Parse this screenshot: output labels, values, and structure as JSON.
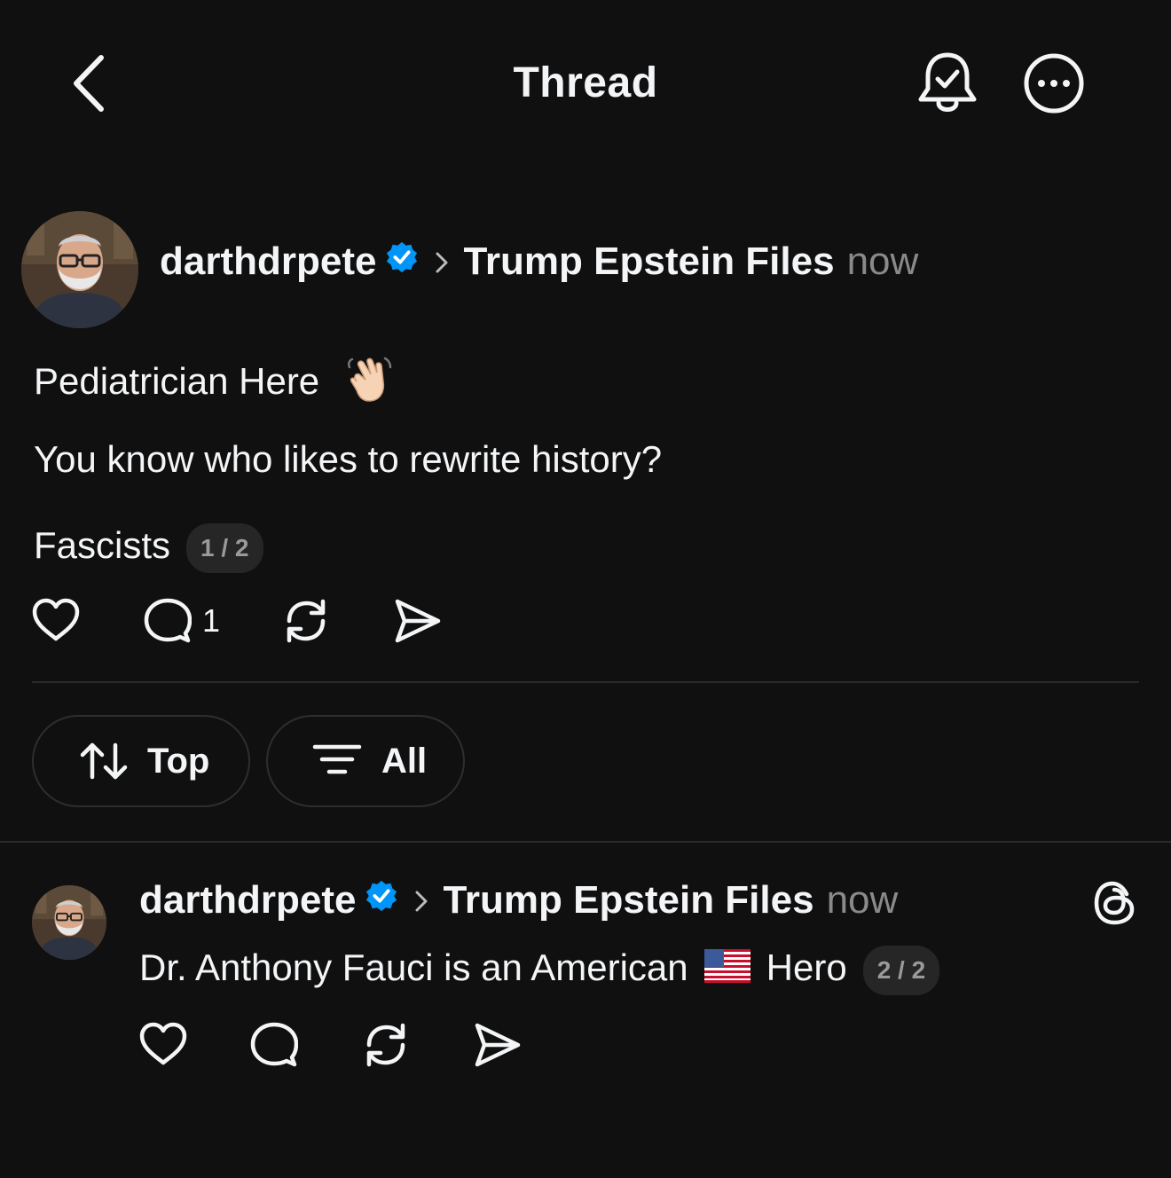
{
  "header": {
    "title": "Thread",
    "icons": {
      "back": "chevron-left-icon",
      "notify": "bell-check-icon",
      "more": "more-dots-icon"
    }
  },
  "post": {
    "username": "darthdrpete",
    "community": "Trump Epstein Files",
    "time": "now",
    "line1": "Pediatrician Here",
    "line1_emoji": "waving-hand-emoji",
    "line2": "You know who likes to rewrite history?",
    "line3": "Fascists",
    "counter": "1 / 2",
    "reply_count": "1"
  },
  "filters": {
    "sort_label": "Top",
    "filter_label": "All"
  },
  "reply": {
    "username": "darthdrpete",
    "community": "Trump Epstein Files",
    "time": "now",
    "text_before": "Dr. Anthony Fauci is an American",
    "text_after": "Hero",
    "flag": "us-flag-emoji",
    "counter": "2 / 2"
  },
  "colors": {
    "background": "#101010",
    "text": "#f3f5f7",
    "muted": "#8a8a8a",
    "verified": "#0095f6",
    "pill_bg": "#262626",
    "divider": "#2a2a2a"
  }
}
